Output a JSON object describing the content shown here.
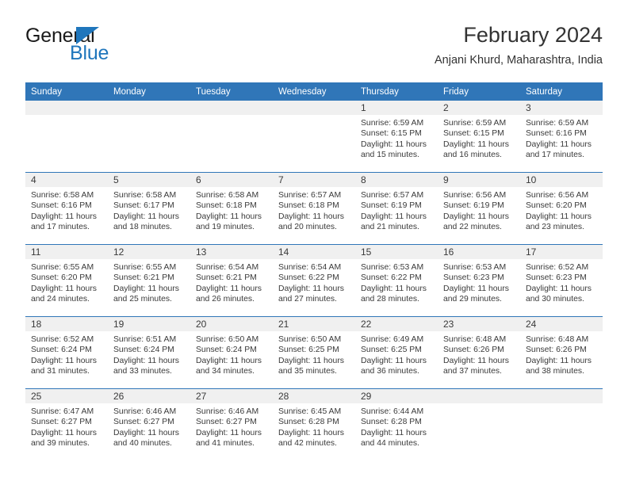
{
  "brand": {
    "name_top": "General",
    "name_bottom": "Blue",
    "triangle_color": "#1f76bc"
  },
  "header": {
    "title": "February 2024",
    "subtitle": "Anjani Khurd, Maharashtra, India"
  },
  "theme": {
    "header_blue": "#3076b8",
    "band_gray": "#f0f0f0",
    "text": "#3a3a3a"
  },
  "columns": [
    "Sunday",
    "Monday",
    "Tuesday",
    "Wednesday",
    "Thursday",
    "Friday",
    "Saturday"
  ],
  "labels": {
    "sunrise_prefix": "Sunrise: ",
    "sunset_prefix": "Sunset: ",
    "daylight_prefix": "Daylight: "
  },
  "weeks": [
    [
      {
        "day": "",
        "sunrise": "",
        "sunset": "",
        "daylight": ""
      },
      {
        "day": "",
        "sunrise": "",
        "sunset": "",
        "daylight": ""
      },
      {
        "day": "",
        "sunrise": "",
        "sunset": "",
        "daylight": ""
      },
      {
        "day": "",
        "sunrise": "",
        "sunset": "",
        "daylight": ""
      },
      {
        "day": "1",
        "sunrise": "Sunrise: 6:59 AM",
        "sunset": "Sunset: 6:15 PM",
        "daylight": "Daylight: 11 hours and 15 minutes."
      },
      {
        "day": "2",
        "sunrise": "Sunrise: 6:59 AM",
        "sunset": "Sunset: 6:15 PM",
        "daylight": "Daylight: 11 hours and 16 minutes."
      },
      {
        "day": "3",
        "sunrise": "Sunrise: 6:59 AM",
        "sunset": "Sunset: 6:16 PM",
        "daylight": "Daylight: 11 hours and 17 minutes."
      }
    ],
    [
      {
        "day": "4",
        "sunrise": "Sunrise: 6:58 AM",
        "sunset": "Sunset: 6:16 PM",
        "daylight": "Daylight: 11 hours and 17 minutes."
      },
      {
        "day": "5",
        "sunrise": "Sunrise: 6:58 AM",
        "sunset": "Sunset: 6:17 PM",
        "daylight": "Daylight: 11 hours and 18 minutes."
      },
      {
        "day": "6",
        "sunrise": "Sunrise: 6:58 AM",
        "sunset": "Sunset: 6:18 PM",
        "daylight": "Daylight: 11 hours and 19 minutes."
      },
      {
        "day": "7",
        "sunrise": "Sunrise: 6:57 AM",
        "sunset": "Sunset: 6:18 PM",
        "daylight": "Daylight: 11 hours and 20 minutes."
      },
      {
        "day": "8",
        "sunrise": "Sunrise: 6:57 AM",
        "sunset": "Sunset: 6:19 PM",
        "daylight": "Daylight: 11 hours and 21 minutes."
      },
      {
        "day": "9",
        "sunrise": "Sunrise: 6:56 AM",
        "sunset": "Sunset: 6:19 PM",
        "daylight": "Daylight: 11 hours and 22 minutes."
      },
      {
        "day": "10",
        "sunrise": "Sunrise: 6:56 AM",
        "sunset": "Sunset: 6:20 PM",
        "daylight": "Daylight: 11 hours and 23 minutes."
      }
    ],
    [
      {
        "day": "11",
        "sunrise": "Sunrise: 6:55 AM",
        "sunset": "Sunset: 6:20 PM",
        "daylight": "Daylight: 11 hours and 24 minutes."
      },
      {
        "day": "12",
        "sunrise": "Sunrise: 6:55 AM",
        "sunset": "Sunset: 6:21 PM",
        "daylight": "Daylight: 11 hours and 25 minutes."
      },
      {
        "day": "13",
        "sunrise": "Sunrise: 6:54 AM",
        "sunset": "Sunset: 6:21 PM",
        "daylight": "Daylight: 11 hours and 26 minutes."
      },
      {
        "day": "14",
        "sunrise": "Sunrise: 6:54 AM",
        "sunset": "Sunset: 6:22 PM",
        "daylight": "Daylight: 11 hours and 27 minutes."
      },
      {
        "day": "15",
        "sunrise": "Sunrise: 6:53 AM",
        "sunset": "Sunset: 6:22 PM",
        "daylight": "Daylight: 11 hours and 28 minutes."
      },
      {
        "day": "16",
        "sunrise": "Sunrise: 6:53 AM",
        "sunset": "Sunset: 6:23 PM",
        "daylight": "Daylight: 11 hours and 29 minutes."
      },
      {
        "day": "17",
        "sunrise": "Sunrise: 6:52 AM",
        "sunset": "Sunset: 6:23 PM",
        "daylight": "Daylight: 11 hours and 30 minutes."
      }
    ],
    [
      {
        "day": "18",
        "sunrise": "Sunrise: 6:52 AM",
        "sunset": "Sunset: 6:24 PM",
        "daylight": "Daylight: 11 hours and 31 minutes."
      },
      {
        "day": "19",
        "sunrise": "Sunrise: 6:51 AM",
        "sunset": "Sunset: 6:24 PM",
        "daylight": "Daylight: 11 hours and 33 minutes."
      },
      {
        "day": "20",
        "sunrise": "Sunrise: 6:50 AM",
        "sunset": "Sunset: 6:24 PM",
        "daylight": "Daylight: 11 hours and 34 minutes."
      },
      {
        "day": "21",
        "sunrise": "Sunrise: 6:50 AM",
        "sunset": "Sunset: 6:25 PM",
        "daylight": "Daylight: 11 hours and 35 minutes."
      },
      {
        "day": "22",
        "sunrise": "Sunrise: 6:49 AM",
        "sunset": "Sunset: 6:25 PM",
        "daylight": "Daylight: 11 hours and 36 minutes."
      },
      {
        "day": "23",
        "sunrise": "Sunrise: 6:48 AM",
        "sunset": "Sunset: 6:26 PM",
        "daylight": "Daylight: 11 hours and 37 minutes."
      },
      {
        "day": "24",
        "sunrise": "Sunrise: 6:48 AM",
        "sunset": "Sunset: 6:26 PM",
        "daylight": "Daylight: 11 hours and 38 minutes."
      }
    ],
    [
      {
        "day": "25",
        "sunrise": "Sunrise: 6:47 AM",
        "sunset": "Sunset: 6:27 PM",
        "daylight": "Daylight: 11 hours and 39 minutes."
      },
      {
        "day": "26",
        "sunrise": "Sunrise: 6:46 AM",
        "sunset": "Sunset: 6:27 PM",
        "daylight": "Daylight: 11 hours and 40 minutes."
      },
      {
        "day": "27",
        "sunrise": "Sunrise: 6:46 AM",
        "sunset": "Sunset: 6:27 PM",
        "daylight": "Daylight: 11 hours and 41 minutes."
      },
      {
        "day": "28",
        "sunrise": "Sunrise: 6:45 AM",
        "sunset": "Sunset: 6:28 PM",
        "daylight": "Daylight: 11 hours and 42 minutes."
      },
      {
        "day": "29",
        "sunrise": "Sunrise: 6:44 AM",
        "sunset": "Sunset: 6:28 PM",
        "daylight": "Daylight: 11 hours and 44 minutes."
      },
      {
        "day": "",
        "sunrise": "",
        "sunset": "",
        "daylight": ""
      },
      {
        "day": "",
        "sunrise": "",
        "sunset": "",
        "daylight": ""
      }
    ]
  ]
}
